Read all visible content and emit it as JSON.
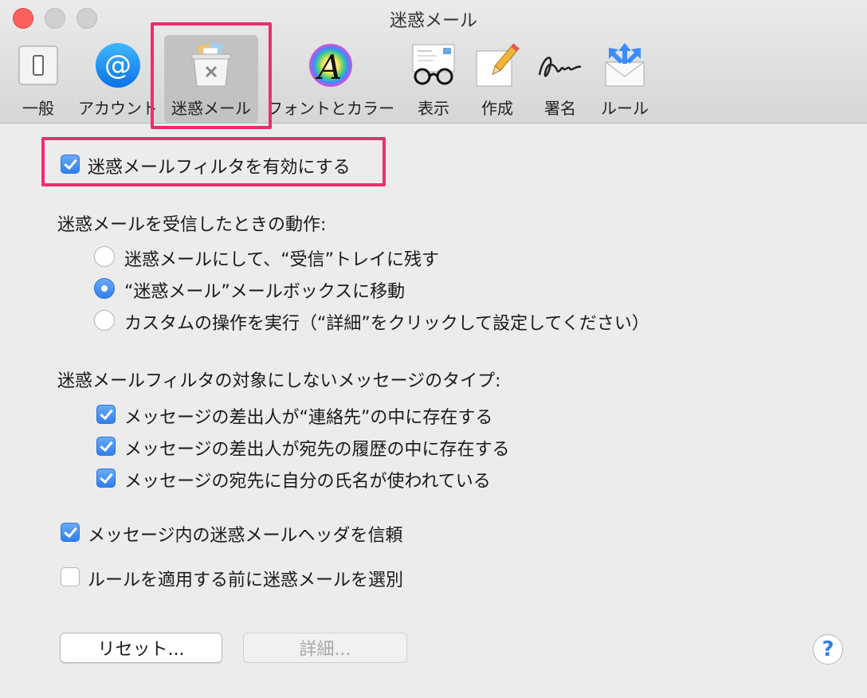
{
  "window": {
    "title": "迷惑メール"
  },
  "toolbar": {
    "items": [
      {
        "label": "一般",
        "icon": "general-switch-icon"
      },
      {
        "label": "アカウント",
        "icon": "at-sign-icon"
      },
      {
        "label": "迷惑メール",
        "icon": "junk-mail-bin-icon",
        "selected": true
      },
      {
        "label": "フォントとカラー",
        "icon": "font-color-icon"
      },
      {
        "label": "表示",
        "icon": "view-glasses-icon"
      },
      {
        "label": "作成",
        "icon": "compose-pencil-icon"
      },
      {
        "label": "署名",
        "icon": "signature-icon"
      },
      {
        "label": "ルール",
        "icon": "rules-arrows-icon"
      }
    ]
  },
  "main": {
    "enable_filter": {
      "label": "迷惑メールフィルタを有効にする",
      "checked": true
    },
    "action_heading": "迷惑メールを受信したときの動作:",
    "action_options": [
      {
        "label": "迷惑メールにして、“受信”トレイに残す",
        "selected": false
      },
      {
        "label": "“迷惑メール”メールボックスに移動",
        "selected": true
      },
      {
        "label": "カスタムの操作を実行（“詳細”をクリックして設定してください）",
        "selected": false
      }
    ],
    "exempt_heading": "迷惑メールフィルタの対象にしないメッセージのタイプ:",
    "exempt_options": [
      {
        "label": "メッセージの差出人が“連絡先”の中に存在する",
        "checked": true
      },
      {
        "label": "メッセージの差出人が宛先の履歴の中に存在する",
        "checked": true
      },
      {
        "label": "メッセージの宛先に自分の氏名が使われている",
        "checked": true
      }
    ],
    "trust_headers": {
      "label": "メッセージ内の迷惑メールヘッダを信頼",
      "checked": true
    },
    "filter_before_rules": {
      "label": "ルールを適用する前に迷惑メールを選別",
      "checked": false
    },
    "reset_button": "リセット...",
    "advanced_button": "詳細...",
    "help_button": "?"
  },
  "colors": {
    "highlight": "#ed2e6c",
    "accent": "#2f7ff0",
    "close_button": "#fc605c"
  }
}
